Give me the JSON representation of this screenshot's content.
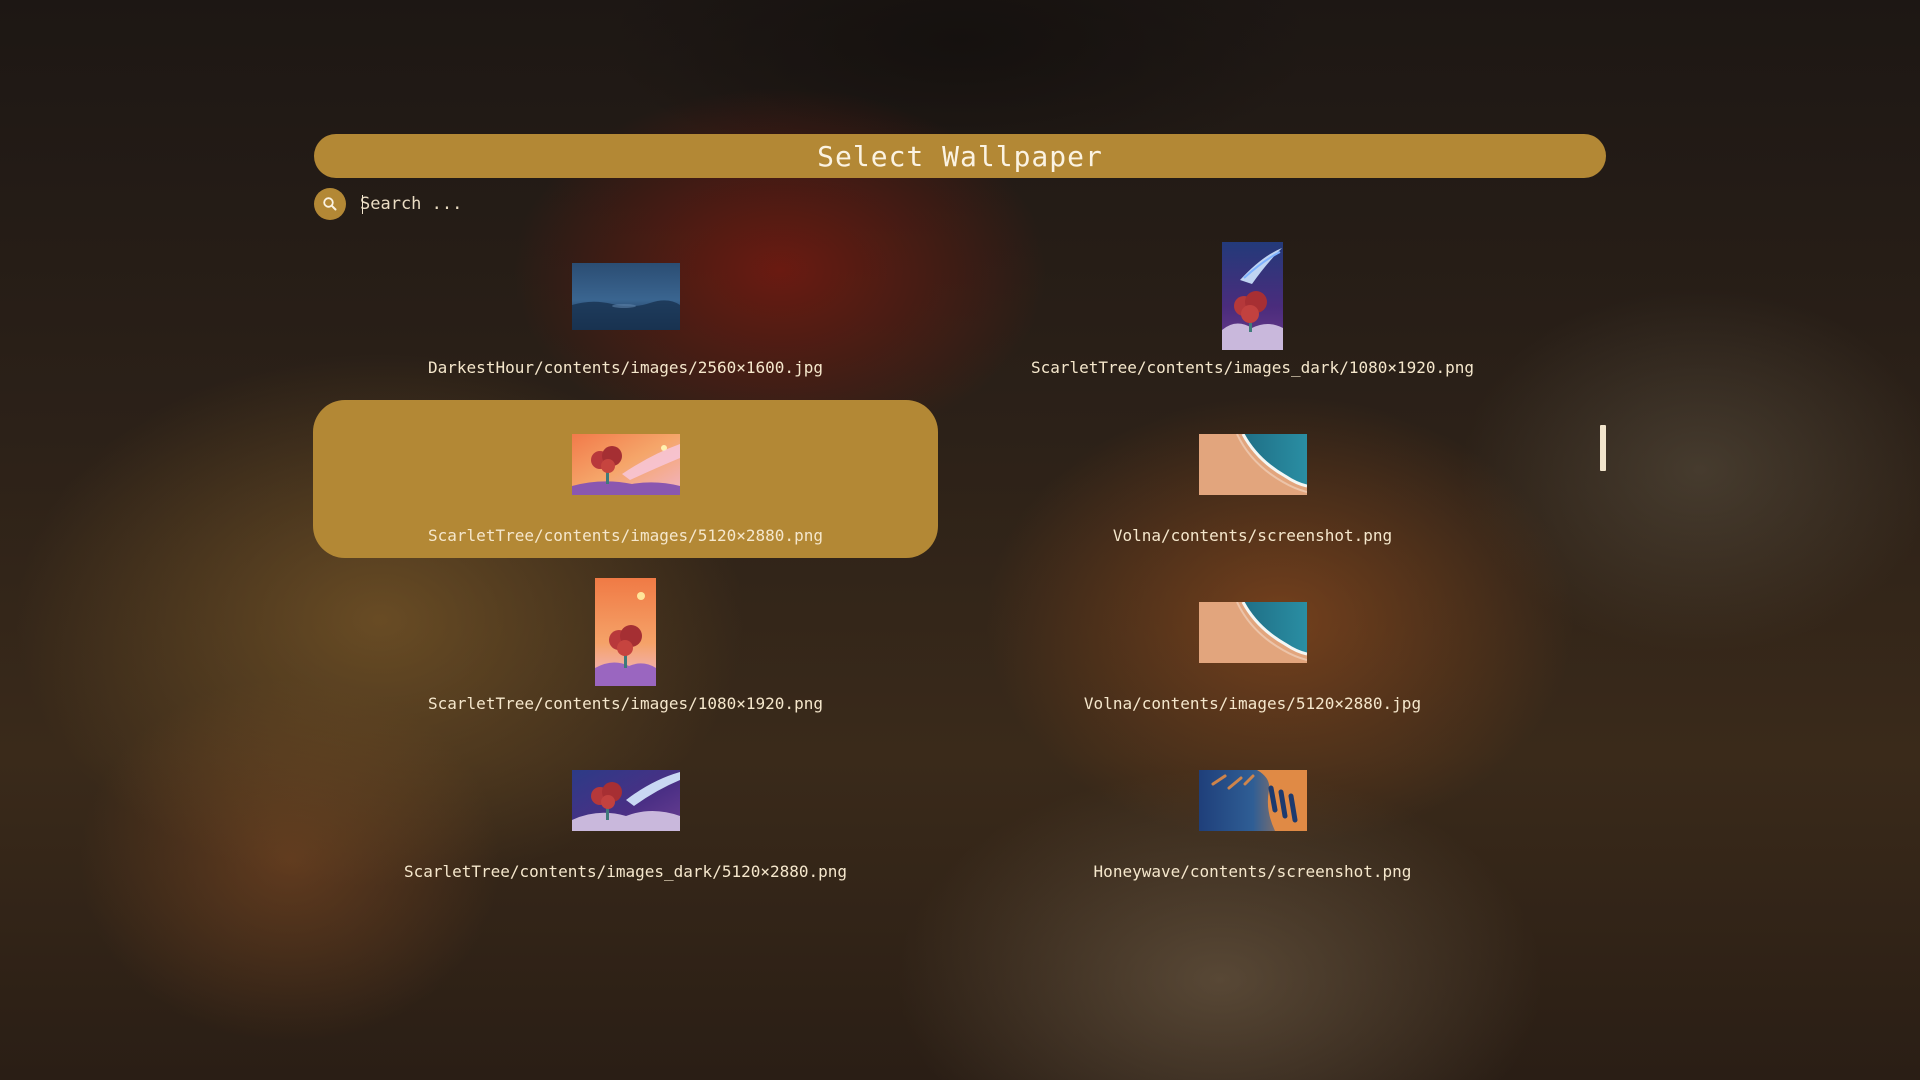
{
  "header": {
    "title": "Select Wallpaper"
  },
  "search": {
    "placeholder": "Search ...",
    "value": ""
  },
  "colors": {
    "accent": "#b38835",
    "text": "#f5e7cc"
  },
  "wallpapers": [
    {
      "label": "DarkestHour/contents/images/2560×1600.jpg",
      "thumb": "darkest-hour",
      "selected": false
    },
    {
      "label": "ScarletTree/contents/images_dark/1080×1920.png",
      "thumb": "scarlet-tree-dark-portrait",
      "selected": false
    },
    {
      "label": "ScarletTree/contents/images/5120×2880.png",
      "thumb": "scarlet-tree-landscape",
      "selected": true
    },
    {
      "label": "Volna/contents/screenshot.png",
      "thumb": "volna-wave",
      "selected": false
    },
    {
      "label": "ScarletTree/contents/images/1080×1920.png",
      "thumb": "scarlet-tree-portrait",
      "selected": false
    },
    {
      "label": "Volna/contents/images/5120×2880.jpg",
      "thumb": "volna-wave",
      "selected": false
    },
    {
      "label": "ScarletTree/contents/images_dark/5120×2880.png",
      "thumb": "scarlet-tree-dark-landscape",
      "selected": false
    },
    {
      "label": "Honeywave/contents/screenshot.png",
      "thumb": "honeywave",
      "selected": false
    }
  ]
}
